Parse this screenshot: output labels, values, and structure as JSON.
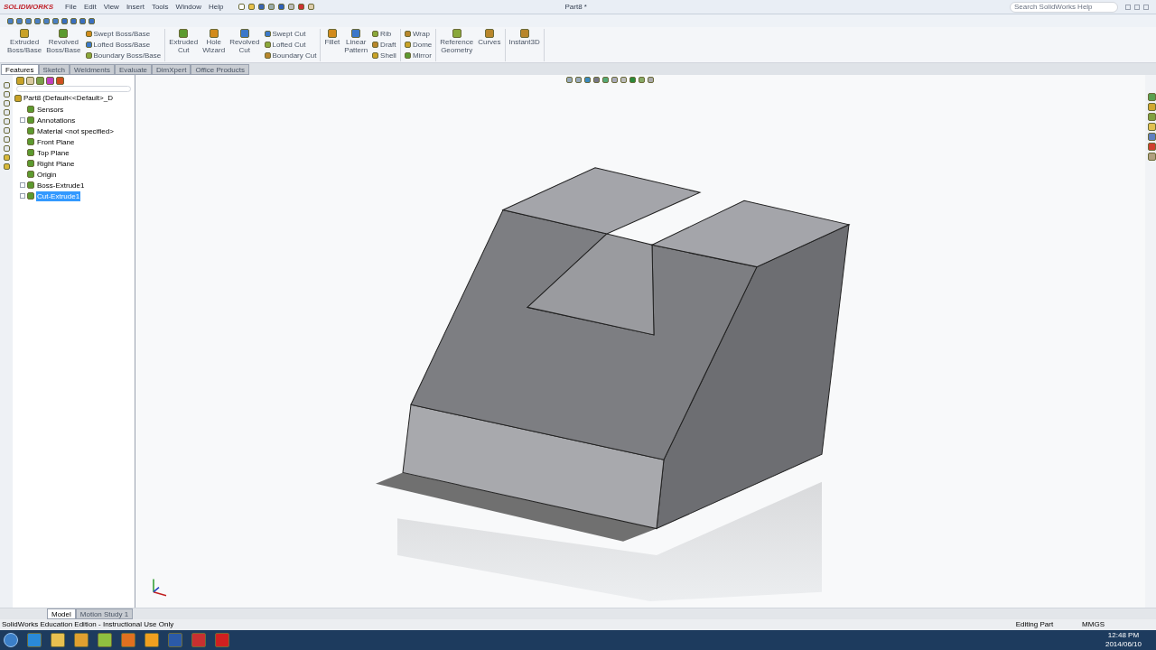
{
  "app": {
    "logo": "SOLIDWORKS",
    "title": "Part8 *",
    "search": {
      "placeholder": "Search SolidWorks Help"
    }
  },
  "menu": [
    "File",
    "Edit",
    "View",
    "Insert",
    "Tools",
    "Window",
    "Help"
  ],
  "command_groups": [
    {
      "large": [
        "Extruded\nBoss/Base",
        "Revolved\nBoss/Base"
      ],
      "small": [
        "Swept Boss/Base",
        "Lofted Boss/Base",
        "Boundary Boss/Base"
      ]
    },
    {
      "large": [
        "Extruded\nCut",
        "Hole\nWizard",
        "Revolved\nCut"
      ],
      "small": [
        "Swept Cut",
        "Lofted Cut",
        "Boundary Cut"
      ]
    },
    {
      "large": [
        "Fillet",
        "Linear\nPattern"
      ],
      "small": [
        "Rib",
        "Draft",
        "Shell"
      ]
    },
    {
      "small": [
        "Wrap",
        "Dome",
        "Mirror"
      ]
    },
    {
      "large": [
        "Reference\nGeometry",
        "Curves"
      ]
    },
    {
      "large": [
        "Instant3D"
      ]
    }
  ],
  "tabs": [
    {
      "label": "Features",
      "selected": true
    },
    {
      "label": "Sketch",
      "selected": false
    },
    {
      "label": "Weldments",
      "selected": false
    },
    {
      "label": "Evaluate",
      "selected": false
    },
    {
      "label": "DimXpert",
      "selected": false
    },
    {
      "label": "Office Products",
      "selected": false
    }
  ],
  "tree": {
    "label": "Part8  (Default<<Default>_D",
    "selected": false,
    "children": [
      {
        "label": "Sensors",
        "selected": false,
        "expandable": false
      },
      {
        "label": "Annotations",
        "selected": false,
        "expandable": true
      },
      {
        "label": "Material <not specified>",
        "selected": false,
        "expandable": false
      },
      {
        "label": "Front Plane",
        "selected": false,
        "expandable": false
      },
      {
        "label": "Top Plane",
        "selected": false,
        "expandable": false
      },
      {
        "label": "Right Plane",
        "selected": false,
        "expandable": false
      },
      {
        "label": "Origin",
        "selected": false,
        "expandable": false
      },
      {
        "label": "Boss-Extrude1",
        "selected": false,
        "expandable": true
      },
      {
        "label": "Cut-Extrude1",
        "selected": true,
        "expandable": true
      }
    ]
  },
  "bottom_tabs": [
    {
      "label": "Model",
      "selected": true
    },
    {
      "label": "Motion Study 1",
      "selected": false
    }
  ],
  "status_bar": {
    "edition": "SolidWorks Education Edition - Instructional Use Only",
    "mode": "Editing Part",
    "units": "MMGS"
  },
  "taskbar": {
    "time": "12:48 PM",
    "date": "2014/06/10"
  }
}
